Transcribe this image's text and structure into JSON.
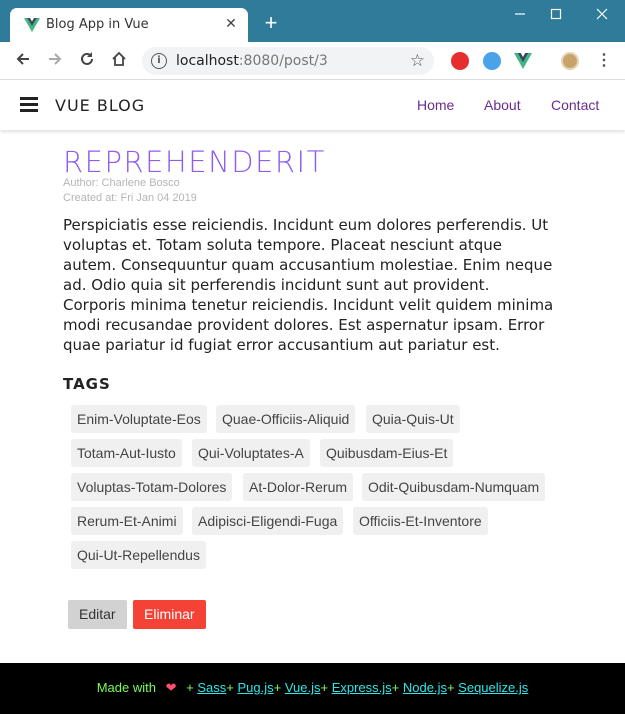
{
  "browser": {
    "tab_title": "Blog App in Vue",
    "url_host": "localhost",
    "url_rest": ":8080/post/3",
    "new_tab_glyph": "+",
    "close_glyph": "✕",
    "icons": [
      "vue-logo-icon",
      "close-icon",
      "plus-icon",
      "minimize-icon",
      "maximize-icon",
      "window-close-icon",
      "back-icon",
      "forward-icon",
      "reload-icon",
      "home-icon",
      "info-icon",
      "star-icon",
      "extension-icon",
      "menu-icon"
    ]
  },
  "header": {
    "brand": "VUE BLOG",
    "nav": [
      "Home",
      "About",
      "Contact"
    ],
    "nav_color": "#6a2c8c"
  },
  "post": {
    "title": "REPREHENDERIT",
    "author": "Author: Charlene Bosco",
    "created": "Created at: Fri Jan 04 2019",
    "body": "Perspiciatis esse reiciendis. Incidunt eum dolores perferendis. Ut voluptas et. Totam soluta tempore. Placeat nesciunt atque autem. Consequuntur quam accusantium molestiae. Enim neque ad. Odio quia sit perferendis incidunt sunt aut provident. Corporis minima tenetur reiciendis. Incidunt velit quidem minima modi recusandae provident dolores. Est aspernatur ipsam. Error quae pariatur id fugiat error accusantium aut pariatur est.",
    "title_color": "#8f5df0"
  },
  "tags": {
    "heading": "TAGS",
    "items": [
      "Enim-Voluptate-Eos",
      "Quae-Officiis-Aliquid",
      "Quia-Quis-Ut",
      "Totam-Aut-Iusto",
      "Qui-Voluptates-A",
      "Quibusdam-Eius-Et",
      "Voluptas-Totam-Dolores",
      "At-Dolor-Rerum",
      "Odit-Quibusdam-Numquam",
      "Rerum-Et-Animi",
      "Adipisci-Eligendi-Fuga",
      "Officiis-Et-Inventore",
      "Qui-Ut-Repellendus"
    ]
  },
  "actions": {
    "edit": "Editar",
    "delete": "Eliminar",
    "delete_color": "#f44336"
  },
  "footer": {
    "made_with": "Made with",
    "heart": "❤",
    "links": [
      {
        "prefix": "+ ",
        "label": "Sass"
      },
      {
        "prefix": "+ ",
        "label": "Pug.js"
      },
      {
        "prefix": "+ ",
        "label": "Vue.js"
      },
      {
        "prefix": "+ ",
        "label": "Express.js"
      },
      {
        "prefix": "+ ",
        "label": "Node.js"
      },
      {
        "prefix": "+ ",
        "label": "Sequelize.js"
      }
    ]
  }
}
